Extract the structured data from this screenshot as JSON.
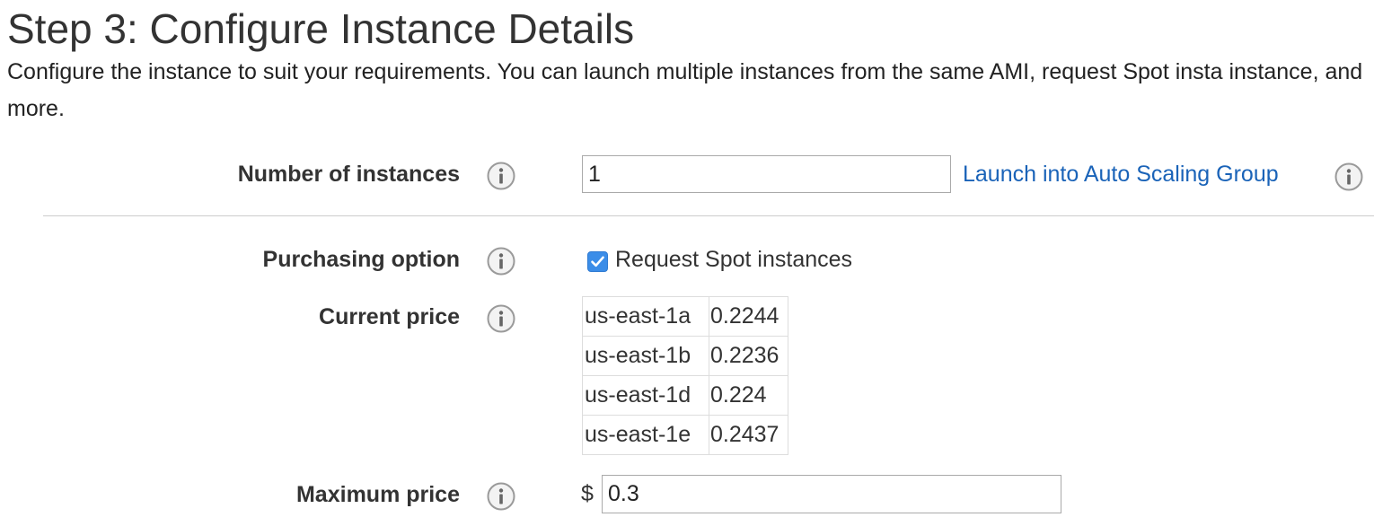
{
  "header": {
    "title": "Step 3: Configure Instance Details",
    "description": "Configure the instance to suit your requirements. You can launch multiple instances from the same AMI, request Spot insta instance, and more."
  },
  "fields": {
    "number_of_instances": {
      "label": "Number of instances",
      "value": "1",
      "link_label": "Launch into Auto Scaling Group"
    },
    "purchasing_option": {
      "label": "Purchasing option",
      "checkbox_label": "Request Spot instances",
      "checked": true
    },
    "current_price": {
      "label": "Current price",
      "rows": [
        {
          "zone": "us-east-1a",
          "price": "0.2244"
        },
        {
          "zone": "us-east-1b",
          "price": "0.2236"
        },
        {
          "zone": "us-east-1d",
          "price": "0.224"
        },
        {
          "zone": "us-east-1e",
          "price": "0.2437"
        }
      ]
    },
    "maximum_price": {
      "label": "Maximum price",
      "currency_symbol": "$",
      "value": "0.3"
    }
  },
  "colors": {
    "link": "#1a63b8",
    "checkbox": "#3b8de8",
    "divider": "#cccccc"
  },
  "icons": {
    "info": "info-circle-icon",
    "check": "checkmark-icon"
  }
}
